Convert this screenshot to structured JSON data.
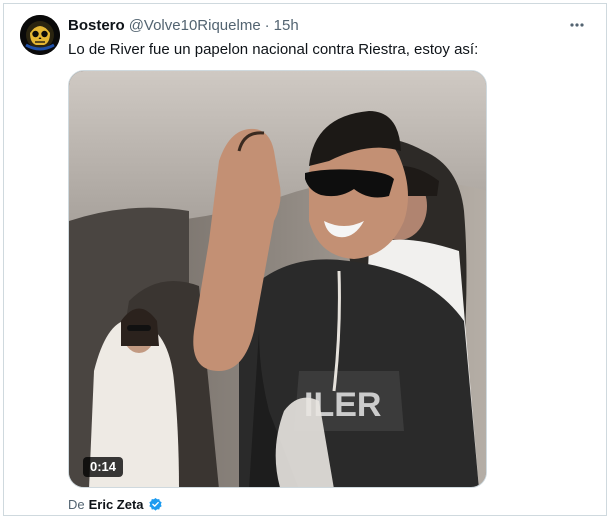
{
  "tweet": {
    "display_name": "Bostero",
    "handle": "@Volve10Riquelme",
    "separator": "·",
    "time": "15h",
    "text": "Lo de River fue un papelon nacional contra Riestra, estoy así:"
  },
  "media": {
    "type": "video",
    "duration": "0:14"
  },
  "attribution": {
    "prefix": "De",
    "name": "Eric Zeta",
    "verified_icon": "verified-badge-icon"
  },
  "colors": {
    "text_primary": "#0f1419",
    "text_secondary": "#536471",
    "border": "#cfd9de",
    "verified_blue": "#1d9bf0"
  }
}
